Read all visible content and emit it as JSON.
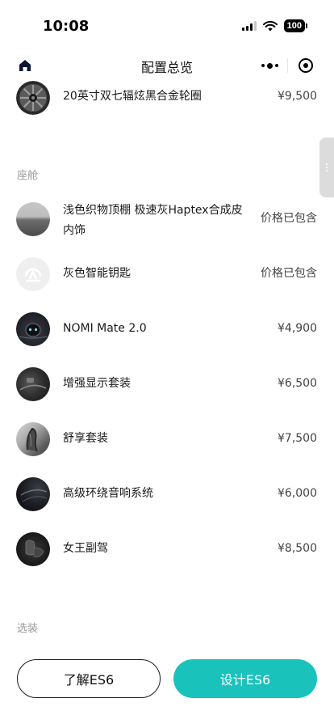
{
  "status_bar": {
    "time": "10:08",
    "battery": "100"
  },
  "nav": {
    "title": "配置总览"
  },
  "wheels_item": {
    "name": "20英寸双七辐炫黑合金轮圈",
    "price": "¥9,500"
  },
  "sections": {
    "cabin": "座舱",
    "options": "选装"
  },
  "cabin_items": [
    {
      "name": "浅色织物顶棚 极速灰Haptex合成皮内饰",
      "price": "价格已包含"
    },
    {
      "name": "灰色智能钥匙",
      "price": "价格已包含"
    },
    {
      "name": "NOMI Mate 2.0",
      "price": "¥4,900"
    },
    {
      "name": "增强显示套装",
      "price": "¥6,500"
    },
    {
      "name": "舒享套装",
      "price": "¥7,500"
    },
    {
      "name": "高级环绕音响系统",
      "price": "¥6,000"
    },
    {
      "name": "女王副驾",
      "price": "¥8,500"
    }
  ],
  "buttons": {
    "learn": "了解ES6",
    "design": "设计ES6"
  },
  "colors": {
    "accent": "#1ac2bc",
    "section_title": "#9a9a9a"
  },
  "icons": {
    "home": "home-icon",
    "more": "more-icon",
    "close": "close-icon",
    "handle": "drag-handle-icon"
  }
}
